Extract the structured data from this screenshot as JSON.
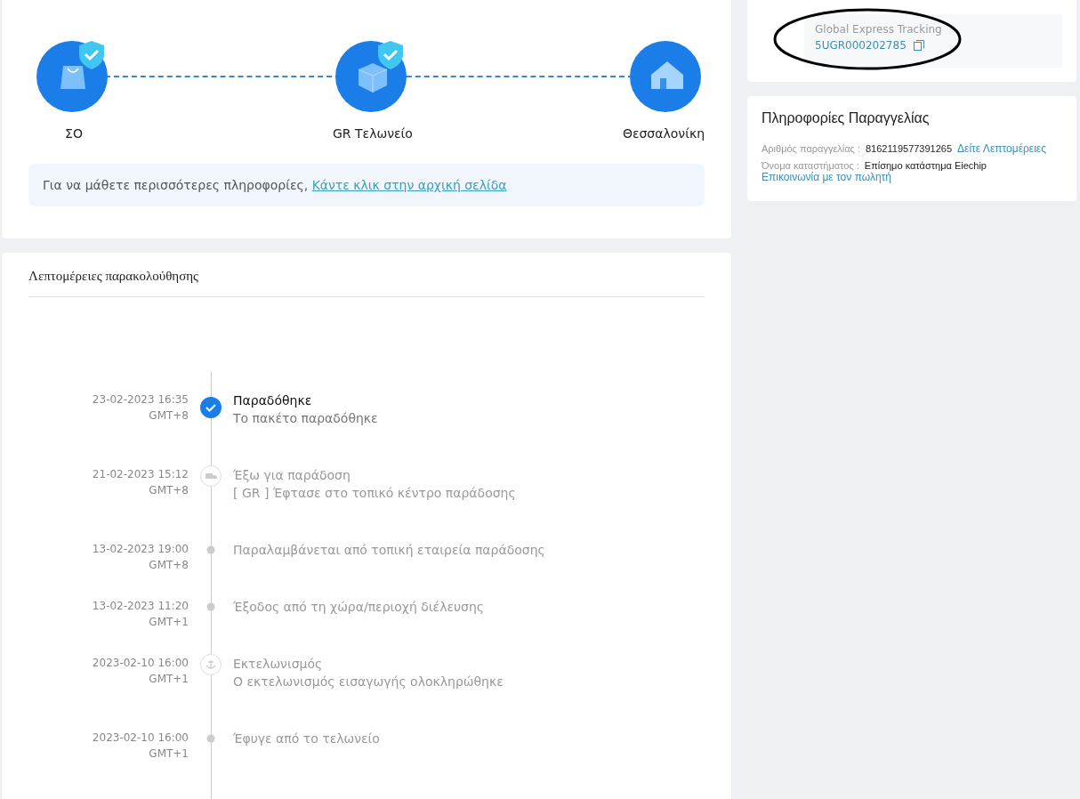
{
  "route": {
    "steps": [
      {
        "label": "ΣΟ",
        "kind": "bag",
        "verified": true
      },
      {
        "label": "GR Τελωνείο",
        "kind": "box",
        "verified": true
      },
      {
        "label": "Θεσσαλονίκη",
        "kind": "house",
        "verified": false
      }
    ],
    "note": {
      "text": "Για να μάθετε περισσότερες πληροφορίες,",
      "link": "Κάντε κλικ στην αρχική σελίδα"
    }
  },
  "tracking": {
    "title": "Λεπτομέρειες παρακολούθησης",
    "events": [
      {
        "time": "23-02-2023 16:35",
        "zone": "GMT+8",
        "title": "Παραδόθηκε",
        "detail": "Το πακέτο παραδόθηκε",
        "kind": "check",
        "current": true
      },
      {
        "time": "21-02-2023 15:12",
        "zone": "GMT+8",
        "title": "Έξω για παράδοση",
        "detail": "[ GR ] Έφτασε στο τοπικό κέντρο παράδοσης",
        "kind": "truck",
        "current": false
      },
      {
        "time": "13-02-2023 19:00",
        "zone": "GMT+8",
        "title": "Παραλαμβάνεται από τοπική εταιρεία παράδοσης",
        "kind": "dot",
        "current": false
      },
      {
        "time": "13-02-2023 11:20",
        "zone": "GMT+1",
        "title": "Έξοδος από τη χώρα/περιοχή διέλευσης",
        "kind": "dot",
        "current": false
      },
      {
        "time": "2023-02-10 16:00",
        "zone": "GMT+1",
        "title": "Εκτελωνισμός",
        "detail": "Ο εκτελωνισμός εισαγωγής ολοκληρώθηκε",
        "kind": "anchor",
        "current": false
      },
      {
        "time": "2023-02-10 16:00",
        "zone": "GMT+1",
        "title": "Έφυγε από το τελωνείο",
        "kind": "dot",
        "current": false
      }
    ]
  },
  "carrier": {
    "label": "Global Express Tracking",
    "number": "5UGR000202785",
    "circled": true
  },
  "order": {
    "title": "Πληροφορίες Παραγγελίας",
    "rows": [
      {
        "label": "Αριθμός παραγγελίας :",
        "value": "8162119577391265",
        "link": "Δείτε Λεπτομέρειες"
      },
      {
        "label": "Όνομα καταστήματος :",
        "value": "Επίσημο κατάστημα Eiechip"
      }
    ],
    "contact": "Επικοινωνία με τον πωλητή"
  }
}
